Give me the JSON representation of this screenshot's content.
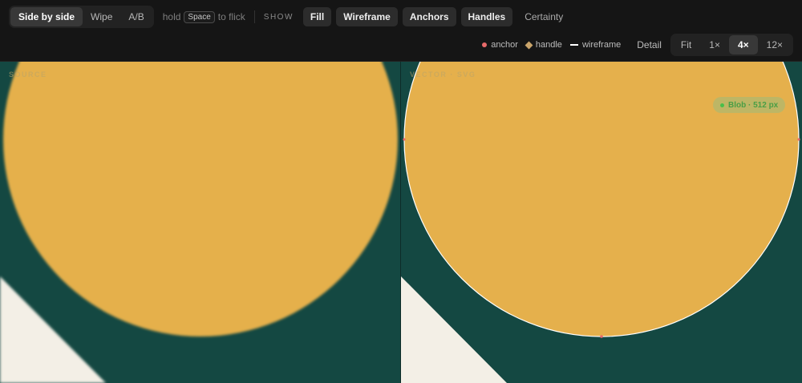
{
  "toolbar": {
    "view_modes": [
      "Side by side",
      "Wipe",
      "A/B"
    ],
    "hint_prefix": "hold",
    "hint_key": "Space",
    "hint_suffix": "to flick",
    "show_label": "SHOW",
    "show_toggles": [
      "Fill",
      "Wireframe",
      "Anchors",
      "Handles",
      "Certainty"
    ],
    "legend": {
      "anchor": "anchor",
      "handle": "handle",
      "wireframe": "wireframe"
    },
    "detail_label": "Detail",
    "zoom_options": [
      "Fit",
      "1×",
      "4×",
      "12×"
    ]
  },
  "panes": {
    "source_label": "SOURCE",
    "vector_label": "VECTOR · SVG",
    "vector_badge": "Blob · 512 px"
  },
  "colors": {
    "background": "#144842",
    "circle": "#e5b04c",
    "triangle": "#f3efe6",
    "anchor": "#e86a6a",
    "handle": "#c9a46a"
  }
}
